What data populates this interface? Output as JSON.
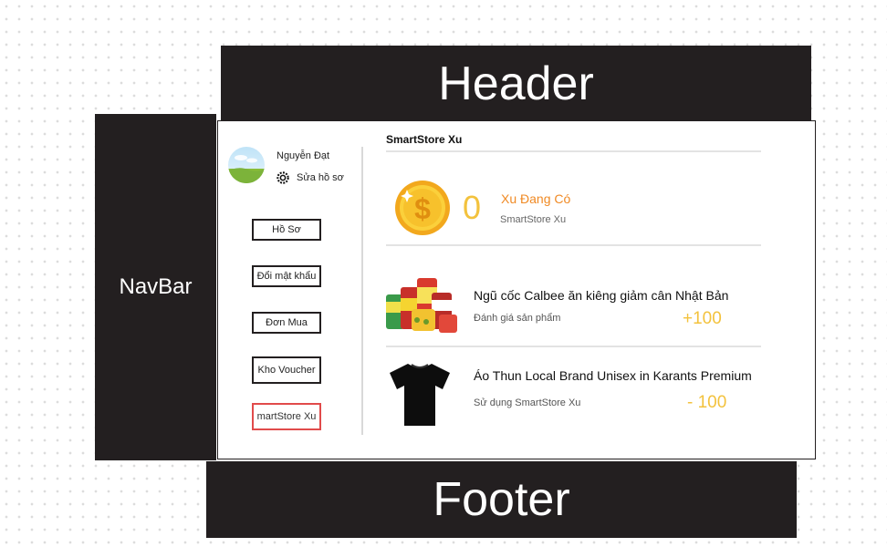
{
  "layout_labels": {
    "header": "Header",
    "navbar": "NavBar",
    "footer": "Footer"
  },
  "profile": {
    "name": "Nguyễn Đạt",
    "edit_label": "Sửa hồ sơ"
  },
  "menu": [
    {
      "label": "Hồ Sơ"
    },
    {
      "label": "Đổi mật khẩu"
    },
    {
      "label": "Đơn Mua"
    },
    {
      "label": "Kho Voucher"
    },
    {
      "label": "martStore Xu",
      "active": true
    }
  ],
  "main": {
    "section_title": "SmartStore Xu",
    "balance": {
      "amount": "0",
      "label": "Xu Đang Có",
      "sub": "SmartStore Xu"
    },
    "transactions": [
      {
        "title": "Ngũ cốc Calbee ăn kiêng giảm cân Nhật Bản",
        "desc": "Đánh giá sản phẩm",
        "amount": "+100",
        "image": "cereal-products"
      },
      {
        "title": "Áo Thun Local Brand Unisex in Karants Premium",
        "desc": "Sử dụng SmartStore Xu",
        "amount": "- 100",
        "image": "black-tshirt"
      }
    ]
  },
  "colors": {
    "dark": "#231f20",
    "accent": "#f3c23d",
    "label_orange": "#f08a24",
    "active_border": "#e14b4b"
  }
}
